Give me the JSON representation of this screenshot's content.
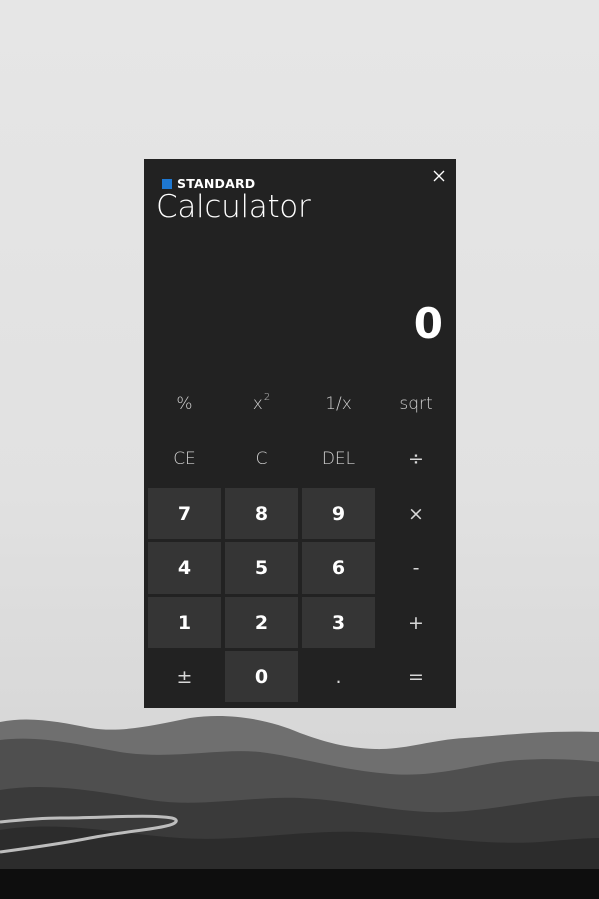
{
  "app": {
    "mode_label": "STANDARD",
    "title": "Calculator",
    "display_value": "0",
    "accent_color": "#1e78d2"
  },
  "icons": {
    "close": "close-icon"
  },
  "keys": {
    "percent": "%",
    "square_base": "x",
    "square_exp": "2",
    "reciprocal": "1/x",
    "sqrt": "sqrt",
    "ce": "CE",
    "c": "C",
    "del": "DEL",
    "divide": "÷",
    "seven": "7",
    "eight": "8",
    "nine": "9",
    "multiply": "×",
    "four": "4",
    "five": "5",
    "six": "6",
    "subtract": "-",
    "one": "1",
    "two": "2",
    "three": "3",
    "add": "+",
    "negate": "±",
    "zero": "0",
    "decimal": ".",
    "equals": "="
  }
}
